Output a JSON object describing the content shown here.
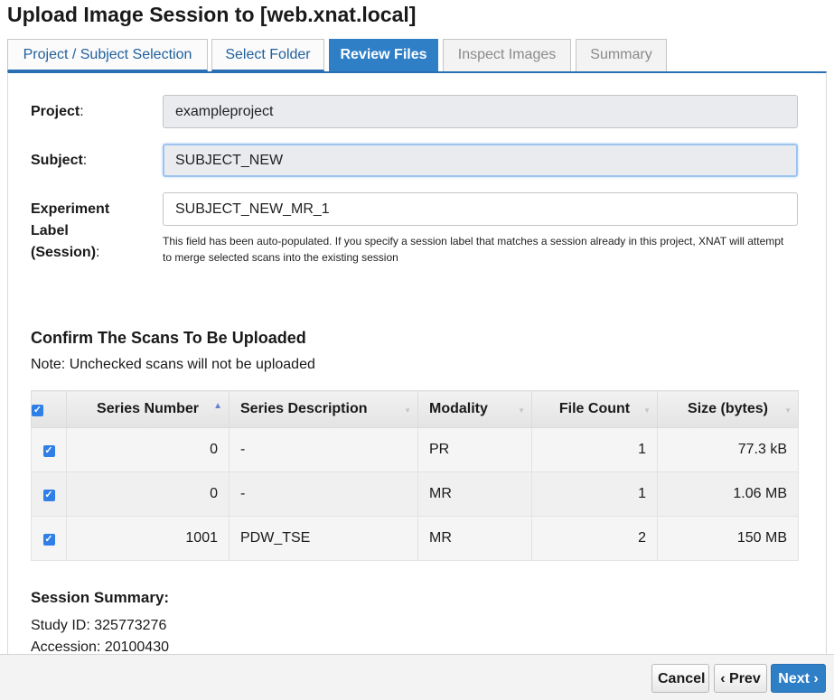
{
  "window": {
    "title": "Upload Image Session to [web.xnat.local]"
  },
  "tabs": [
    {
      "label": "Project / Subject Selection",
      "state": "done"
    },
    {
      "label": "Select Folder",
      "state": "done"
    },
    {
      "label": "Review Files",
      "state": "active"
    },
    {
      "label": "Inspect Images",
      "state": "disabled"
    },
    {
      "label": "Summary",
      "state": "disabled"
    }
  ],
  "form": {
    "project_label": "Project",
    "project_value": "exampleproject",
    "subject_label": "Subject",
    "subject_value": "SUBJECT_NEW",
    "experiment_label_line1": "Experiment",
    "experiment_label_line2": "Label",
    "experiment_label_line3": "(Session)",
    "experiment_value": "SUBJECT_NEW_MR_1",
    "help_text": "This field has been auto-populated. If you specify a session label that matches a session already in this project, XNAT will attempt to merge selected scans into the existing session"
  },
  "scans": {
    "heading": "Confirm The Scans To Be Uploaded",
    "note": "Note: Unchecked scans will not be uploaded",
    "columns": [
      "Series Number",
      "Series Description",
      "Modality",
      "File Count",
      "Size (bytes)"
    ],
    "rows": [
      {
        "checked": true,
        "series_number": "0",
        "description": "-",
        "modality": "PR",
        "file_count": "1",
        "size": "77.3 kB"
      },
      {
        "checked": true,
        "series_number": "0",
        "description": "-",
        "modality": "MR",
        "file_count": "1",
        "size": "1.06 MB"
      },
      {
        "checked": true,
        "series_number": "1001",
        "description": "PDW_TSE",
        "modality": "MR",
        "file_count": "2",
        "size": "150 MB"
      }
    ]
  },
  "session_summary": {
    "heading": "Session Summary:",
    "study_id": "Study ID: 325773276",
    "accession": "Accession: 20100430"
  },
  "footer": {
    "cancel_label": "Cancel",
    "prev_label": "Prev",
    "next_label": "Next"
  },
  "colors": {
    "accent": "#2f7fc7",
    "checkbox": "#2f7fe8"
  }
}
